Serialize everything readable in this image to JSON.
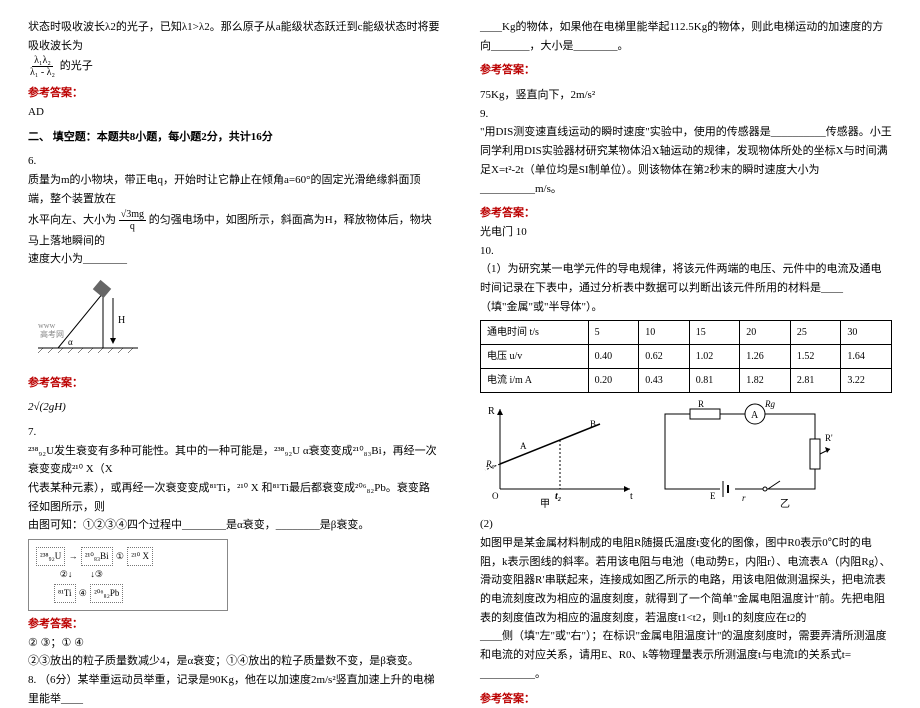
{
  "left": {
    "p1a": "状态时吸收波长λ2的光子，已知λ1>λ2。那么原子从a能级状态跃迁到c能级状态时将要吸收波长为",
    "p1b": "的光子",
    "frac1": {
      "num": "λ₁λ₂",
      "den": "λ₁ - λ₂"
    },
    "ans_heading": "参考答案：",
    "ans1": "AD",
    "section2": "二、 填空题：本题共8小题，每小题2分，共计16分",
    "q6_no": "6.",
    "q6_a": "质量为m的小物块，带正电q，开始时让它静止在倾角a=",
    "q6_angle": "60°",
    "q6_b": "的固定光滑绝缘斜面顶端，整个装置放在",
    "q6_c": "水平向左、大小为",
    "frac2": {
      "num": "√3mg",
      "den": "q"
    },
    "q6_d": "的匀强电场中，如图所示，斜面高为H，释放物体后，物块马上落地瞬间的",
    "q6_e": "速度大小为________",
    "ans6": "2√(2gH)",
    "q7_no": "7.",
    "q7_a": "发生衰变有多种可能性。其中的一种可能是，",
    "iso_u": "²³⁸₉₂U",
    "q7_b": " α衰变变成",
    "iso_bi": "²¹⁰₈₃Bi",
    "q7_c": "，再经一次衰变变成",
    "iso_x": "²¹⁰ X",
    "q7_d": "（X",
    "q7_e": "代表某种元素），或再经一次衰变变成",
    "iso_ti": "⁸¹Ti",
    "q7_f": "，",
    "q7_g": " 和",
    "q7_h": "最后都衰变成",
    "iso_pb": "²⁰⁶₈₂Pb",
    "q7_i": "。衰变路径如图所示，则",
    "q7_j": "由图可知：①②③④四个过程中________是α衰变，________是β衰变。",
    "proc_u": "²³⁸₉₂U",
    "proc_bi": "²¹⁰₈₃Bi",
    "proc_x": "²¹⁰ X",
    "proc_ti": "⁸¹Ti",
    "proc_pb": "²⁰⁶₈₂Pb",
    "proc_a1": "①",
    "proc_a2": "②",
    "proc_a3": "③",
    "proc_a4": "④",
    "ans7a": "② ③；① ④",
    "ans7b": "②③放出的粒子质量数减少4，是α衰变；①④放出的粒子质量数不变，是β衰变。",
    "q8_no": "8.",
    "q8": "（6分）某举重运动员举重，记录是90Kg，他在以加速度2m/s²竖直加速上升的电梯里能举____"
  },
  "right": {
    "p8b": "____Kg的物体，如果他在电梯里能举起112.5Kg的物体，则此电梯运动的加速度的方向_______，大小是________。",
    "ans_heading": "参考答案：",
    "ans8": "75Kg，竖直向下，2m/s²",
    "q9_no": "9.",
    "q9a": "\"用DIS测变速直线运动的瞬时速度\"实验中，使用的传感器是__________传感器。小王同学利用DIS实验器材研究某物体沿X轴运动的规律，发现物体所处的坐标X与时间满足X=t²-2t（单位均是SI制单位）。则该物体在第2秒末的瞬时速度大小为__________m/s。",
    "ans9": "光电门    10",
    "q10_no": "10.",
    "q10a": "（1）为研究某一电学元件的导电规律，将该元件两端的电压、元件中的电流及通电时间记录在下表中，通过分析表中数据可以判断出该元件所用的材料是____",
    "q10b": "（填\"金属\"或\"半导体\"）。",
    "table": {
      "headers": [
        "通电时间 t/s",
        "5",
        "10",
        "15",
        "20",
        "25",
        "30"
      ],
      "row_u": [
        "电压  u/v",
        "0.40",
        "0.62",
        "1.02",
        "1.26",
        "1.52",
        "1.64"
      ],
      "row_i": [
        "电流  i/m A",
        "0.20",
        "0.43",
        "0.81",
        "1.82",
        "2.81",
        "3.22"
      ]
    },
    "graph": {
      "ylabel": "R",
      "xlabel": "t",
      "a": "A",
      "b": "B",
      "r0": "R₀",
      "t2": "t₂",
      "cap": "甲"
    },
    "circuit": {
      "r": "R",
      "a": "A",
      "rg": "Rg",
      "rp": "R'",
      "e": "E",
      "r2": "r",
      "cap": "乙"
    },
    "q10c": "(2)",
    "q10d": "如图甲是某金属材料制成的电阻R随摄氏温度t变化的图像，图中R0表示0℃时的电阻，k表示图线的斜率。若用该电阻与电池（电动势E，内阻r）、电流表A（内阻Rg）、滑动变阻器R′串联起来，连接成如图乙所示的电路，用该电阻做测温探头，把电流表的电流刻度改为相应的温度刻度，就得到了一个简单\"金属电阻温度计\"前。先把电阻",
    "q10e": "表的刻度值改为相应的温度刻度，若温度t1<t2，则t1的刻度应在t2的",
    "q10f": "____侧（填\"左\"或\"右\"）；在标识\"金属电阻温度计\"的温度刻度时，需要弄清所测温度和电流的对应关系，请用E、R0、k等物理量表示所测温度t与电流I的关系式t= __________。",
    "ans10_heading": "参考答案："
  }
}
